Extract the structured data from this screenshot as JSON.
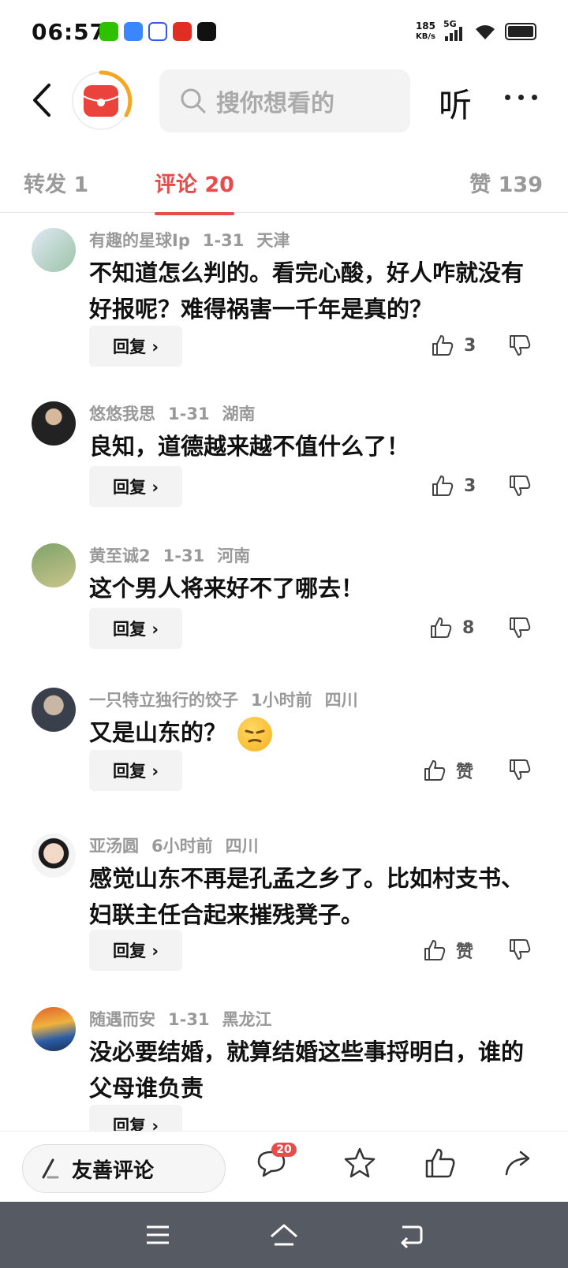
{
  "status_bar": {
    "time": "06:57",
    "net_speed_value": "185",
    "net_speed_unit": "KB/s",
    "network": "5G"
  },
  "header": {
    "search_placeholder": "搜你想看的",
    "listen_label": "听"
  },
  "tabs": {
    "forward": "转发 1",
    "comment": "评论 20",
    "like": "赞 139"
  },
  "comments": [
    {
      "user": "有趣的星球Ip",
      "date": "1-31",
      "region": "天津",
      "text": "不知道怎么判的。看完心酸，好人咋就没有好报呢？难得祸害一千年是真的？",
      "reply_label": "回复 ›",
      "likes": "3"
    },
    {
      "user": "悠悠我思",
      "date": "1-31",
      "region": "湖南",
      "text": "良知，道德越来越不值什么了！",
      "reply_label": "回复 ›",
      "likes": "3"
    },
    {
      "user": "黄至诚2",
      "date": "1-31",
      "region": "河南",
      "text": "这个男人将来好不了哪去！",
      "reply_label": "回复 ›",
      "likes": "8"
    },
    {
      "user": "一只特立独行的饺子",
      "date": "1小时前",
      "region": "四川",
      "text": "又是山东的？",
      "reply_label": "回复 ›",
      "likes": "赞"
    },
    {
      "user": "亚汤圆",
      "date": "6小时前",
      "region": "四川",
      "text": "感觉山东不再是孔孟之乡了。比如村支书、妇联主任合起来摧残凳子。",
      "reply_label": "回复 ›",
      "likes": "赞"
    },
    {
      "user": "随遇而安",
      "date": "1-31",
      "region": "黑龙江",
      "text": "没必要结婚，就算结婚这些事捋明白，谁的父母谁负责",
      "reply_label": "回复 ›",
      "likes": ""
    }
  ],
  "bottom_bar": {
    "comment_input_label": "友善评论",
    "comment_count_badge": "20"
  },
  "colors": {
    "accent": "#e64c4c",
    "muted_text": "#999999",
    "nav_bar": "#555a63"
  }
}
